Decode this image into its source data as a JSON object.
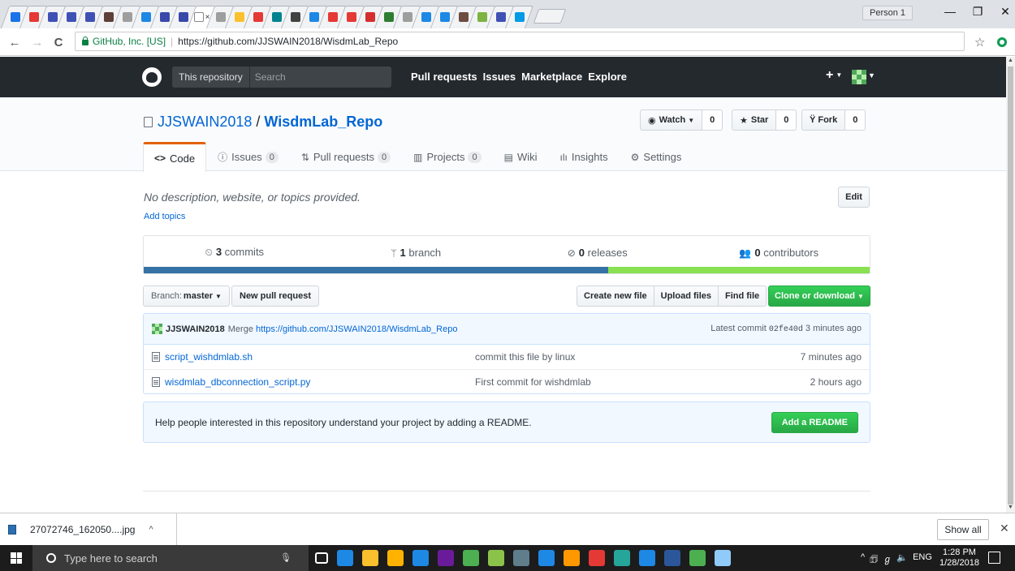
{
  "browser": {
    "tabs": [
      {
        "color": "#1a73e8"
      },
      {
        "color": "#e53935"
      },
      {
        "color": "#3f51b5"
      },
      {
        "color": "#3f51b5"
      },
      {
        "color": "#3f51b5"
      },
      {
        "color": "#5d4037"
      },
      {
        "color": "#9e9e9e"
      },
      {
        "color": "#1e88e5"
      },
      {
        "color": "#3949ab"
      },
      {
        "color": "#3949ab"
      },
      {
        "color": "#ffffff",
        "active": true
      },
      {
        "color": "#9e9e9e"
      },
      {
        "color": "#fbc02d"
      },
      {
        "color": "#e53935"
      },
      {
        "color": "#00838f"
      },
      {
        "color": "#424242"
      },
      {
        "color": "#1e88e5"
      },
      {
        "color": "#e53935"
      },
      {
        "color": "#e53935"
      },
      {
        "color": "#d32f2f"
      },
      {
        "color": "#2e7d32"
      },
      {
        "color": "#9e9e9e"
      },
      {
        "color": "#1e88e5"
      },
      {
        "color": "#1e88e5"
      },
      {
        "color": "#6d4c41"
      },
      {
        "color": "#7cb342"
      },
      {
        "color": "#3f51b5"
      },
      {
        "color": "#039be5"
      }
    ],
    "active_tab_close": "×",
    "person": "Person 1",
    "controls": {
      "minimize": "—",
      "restore": "❐",
      "close": "✕"
    },
    "nav": {
      "back": "←",
      "forward": "→",
      "reload": "C"
    },
    "secure_label": "GitHub, Inc. [US]",
    "url": "https://github.com/JJSWAIN2018/WisdmLab_Repo",
    "bookmark_star": "☆"
  },
  "header": {
    "scope": "This repository",
    "search_placeholder": "Search",
    "nav": [
      "Pull requests",
      "Issues",
      "Marketplace",
      "Explore"
    ],
    "plus": "+"
  },
  "repo": {
    "owner": "JJSWAIN2018",
    "slash": "/",
    "name": "WisdmLab_Repo",
    "watch": {
      "label": "Watch",
      "count": "0"
    },
    "star": {
      "label": "Star",
      "count": "0"
    },
    "fork": {
      "label": "Fork",
      "count": "0"
    },
    "tabs": [
      {
        "icon": "<>",
        "label": "Code",
        "count": null,
        "selected": true
      },
      {
        "icon": "ⓘ",
        "label": "Issues",
        "count": "0"
      },
      {
        "icon": "⇅",
        "label": "Pull requests",
        "count": "0"
      },
      {
        "icon": "▥",
        "label": "Projects",
        "count": "0"
      },
      {
        "icon": "▤",
        "label": "Wiki",
        "count": null
      },
      {
        "icon": "ılı",
        "label": "Insights",
        "count": null
      },
      {
        "icon": "⚙",
        "label": "Settings",
        "count": null
      }
    ],
    "description": "No description, website, or topics provided.",
    "add_topics": "Add topics",
    "edit": "Edit"
  },
  "summary": {
    "commits": {
      "num": "3",
      "label": "commits"
    },
    "branches": {
      "num": "1",
      "label": "branch"
    },
    "releases": {
      "num": "0",
      "label": "releases"
    },
    "contributors": {
      "num": "0",
      "label": "contributors"
    },
    "lang_colors": [
      "#3572a5",
      "#89e051"
    ],
    "lang_shares": [
      0.64,
      0.36
    ]
  },
  "filenav": {
    "branch_label": "Branch:",
    "branch": "master",
    "new_pr": "New pull request",
    "create": "Create new file",
    "upload": "Upload files",
    "find": "Find file",
    "clone": "Clone or download"
  },
  "commit": {
    "author": "JJSWAIN2018",
    "message": "Merge",
    "message_link": "https://github.com/JJSWAIN2018/WisdmLab_Repo",
    "latest_label": "Latest commit",
    "sha": "02fe40d",
    "when": "3 minutes ago"
  },
  "files": [
    {
      "name": "script_wishdmlab.sh",
      "message": "commit this file by linux",
      "age": "7 minutes ago"
    },
    {
      "name": "wisdmlab_dbconnection_script.py",
      "message": "First commit for wishdmlab",
      "age": "2 hours ago"
    }
  ],
  "readme": {
    "text": "Help people interested in this repository understand your project by adding a README.",
    "button": "Add a README"
  },
  "downloads": {
    "file": "27072746_162050....jpg",
    "caret": "^",
    "show_all": "Show all",
    "close": "✕"
  },
  "taskbar": {
    "search_placeholder": "Type here to search",
    "icon_colors": [
      "#ffffff",
      "#1e88e5",
      "#fbc02d",
      "#ffb300",
      "#1e88e5",
      "#6a1b9a",
      "#4caf50",
      "#8bc34a",
      "#607d8b",
      "#1e88e5",
      "#ff9800",
      "#e53935",
      "#26a69a",
      "#1e88e5",
      "#2b579a",
      "#4caf50",
      "#90caf9"
    ],
    "tray": [
      "^",
      "🗊",
      "ℊ",
      "🔈",
      "ENG"
    ],
    "time": "1:28 PM",
    "date": "1/28/2018"
  }
}
